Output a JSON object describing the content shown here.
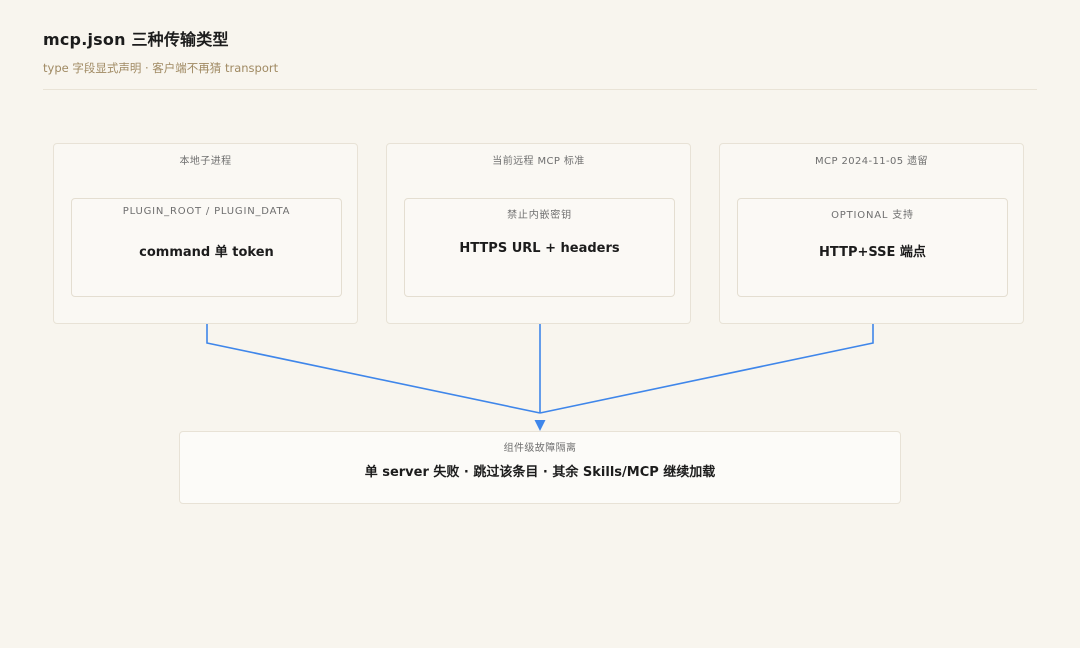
{
  "header": {
    "title": "mcp.json 三种传输类型",
    "subtitle": "type 字段显式声明 · 客户端不再猜 transport"
  },
  "cards": [
    {
      "label": "本地子进程",
      "inner_label": "PLUGIN_ROOT / PLUGIN_DATA",
      "inner_main": "command 单 token"
    },
    {
      "label": "当前远程 MCP 标准",
      "inner_label": "禁止内嵌密钥",
      "inner_main": "HTTPS URL + headers"
    },
    {
      "label": "MCP 2024-11-05 遗留",
      "inner_label": "OPTIONAL 支持",
      "inner_main": "HTTP+SSE 端点"
    }
  ],
  "target": {
    "label": "组件级故障隔离",
    "main": "单 server 失败 · 跳过该条目 · 其余 Skills/MCP 继续加载"
  },
  "colors": {
    "connector": "#3f86ea",
    "background": "#f8f5ee",
    "subtitle": "#a08a63"
  }
}
